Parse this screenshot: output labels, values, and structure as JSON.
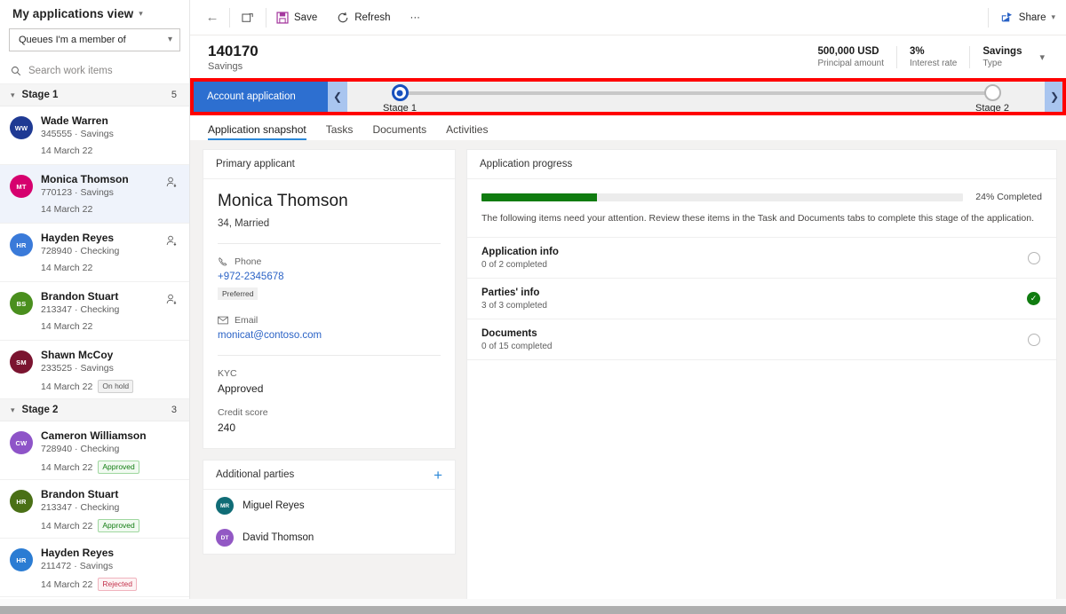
{
  "sidebar": {
    "view_title": "My applications view",
    "queue_selector": {
      "value": "Queues I'm a member of",
      "icon": "chevron-down-icon"
    },
    "search": {
      "placeholder": "Search work items",
      "icon": "search-icon"
    },
    "groups": [
      {
        "name": "Stage 1",
        "count": "5",
        "items": [
          {
            "initials": "WW",
            "color": "#1f3a93",
            "name": "Wade Warren",
            "id": "345555",
            "product": "Savings",
            "date": "14 March 22",
            "status": "",
            "selected": false,
            "has_assign_icon": false
          },
          {
            "initials": "MT",
            "color": "#d6006e",
            "name": "Monica Thomson",
            "id": "770123",
            "product": "Savings",
            "date": "14 March 22",
            "status": "",
            "selected": true,
            "has_assign_icon": true
          },
          {
            "initials": "HR",
            "color": "#3a7ad9",
            "name": "Hayden Reyes",
            "id": "728940",
            "product": "Checking",
            "date": "14 March 22",
            "status": "",
            "selected": false,
            "has_assign_icon": true
          },
          {
            "initials": "BS",
            "color": "#4a8f1e",
            "name": "Brandon Stuart",
            "id": "213347",
            "product": "Checking",
            "date": "14 March 22",
            "status": "",
            "selected": false,
            "has_assign_icon": true
          },
          {
            "initials": "SM",
            "color": "#7b1430",
            "name": "Shawn McCoy",
            "id": "233525",
            "product": "Savings",
            "date": "14 March 22",
            "status": "On hold",
            "status_kind": "onhold",
            "selected": false,
            "has_assign_icon": false
          }
        ]
      },
      {
        "name": "Stage 2",
        "count": "3",
        "items": [
          {
            "initials": "CW",
            "color": "#8e54c8",
            "name": "Cameron Williamson",
            "id": "728940",
            "product": "Checking",
            "date": "14 March 22",
            "status": "Approved",
            "status_kind": "approved",
            "selected": false,
            "has_assign_icon": false
          },
          {
            "initials": "HR",
            "color": "#4a7016",
            "name": "Brandon Stuart",
            "id": "213347",
            "product": "Checking",
            "date": "14 March 22",
            "status": "Approved",
            "status_kind": "approved",
            "selected": false,
            "has_assign_icon": false
          },
          {
            "initials": "HR",
            "color": "#2b7cd3",
            "name": "Hayden Reyes",
            "id": "211472",
            "product": "Savings",
            "date": "14 March 22",
            "status": "Rejected",
            "status_kind": "rejected",
            "selected": false,
            "has_assign_icon": false
          }
        ]
      }
    ]
  },
  "commandbar": {
    "back_icon": "back-arrow-icon",
    "new_icon": "new-window-icon",
    "save_label": "Save",
    "save_icon": "save-disk-icon",
    "refresh_label": "Refresh",
    "refresh_icon": "refresh-icon",
    "overflow_label": "···",
    "share_label": "Share",
    "share_icon": "share-icon",
    "share_chevron": "chevron-down-icon"
  },
  "record": {
    "title": "140170",
    "subtitle": "Savings",
    "metrics": [
      {
        "value": "500,000 USD",
        "label": "Principal amount"
      },
      {
        "value": "3%",
        "label": "Interest rate"
      },
      {
        "value": "Savings",
        "label": "Type"
      }
    ],
    "expand_icon": "chevron-down-icon"
  },
  "process_flow": {
    "stage_label": "Account application",
    "prev_icon": "chevron-left-icon",
    "next_icon": "chevron-right-icon",
    "nodes": [
      {
        "label": "Stage 1",
        "active": true
      },
      {
        "label": "Stage 2",
        "active": false
      }
    ],
    "highlight_color": "#ff0000"
  },
  "tabs": [
    {
      "label": "Application snapshot",
      "active": true
    },
    {
      "label": "Tasks",
      "active": false
    },
    {
      "label": "Documents",
      "active": false
    },
    {
      "label": "Activities",
      "active": false
    }
  ],
  "primary_applicant": {
    "card_title": "Primary applicant",
    "name": "Monica Thomson",
    "meta": "34, Married",
    "phone_label": "Phone",
    "phone_icon": "phone-icon",
    "phone_value": "+972-2345678",
    "phone_badge": "Preferred",
    "email_label": "Email",
    "email_icon": "mail-icon",
    "email_value": "monicat@contoso.com",
    "kyc_label": "KYC",
    "kyc_value": "Approved",
    "credit_label": "Credit score",
    "credit_value": "240"
  },
  "additional_parties": {
    "card_title": "Additional parties",
    "add_icon": "plus-icon",
    "items": [
      {
        "initials": "MR",
        "color": "#106c76",
        "name": "Miguel Reyes"
      },
      {
        "initials": "DT",
        "color": "#9258c4",
        "name": "David Thomson"
      }
    ]
  },
  "application_progress": {
    "card_title": "Application progress",
    "percent": 24,
    "percent_label": "24% Completed",
    "bar_color": "#107c10",
    "note": "The following items need your attention. Review these items in the Task and Documents tabs to complete this stage of the application.",
    "checklist": [
      {
        "title": "Application info",
        "sub": "0 of 2 completed",
        "done": false
      },
      {
        "title": "Parties' info",
        "sub": "3 of 3 completed",
        "done": true
      },
      {
        "title": "Documents",
        "sub": "0 of 15 completed",
        "done": false
      }
    ]
  }
}
